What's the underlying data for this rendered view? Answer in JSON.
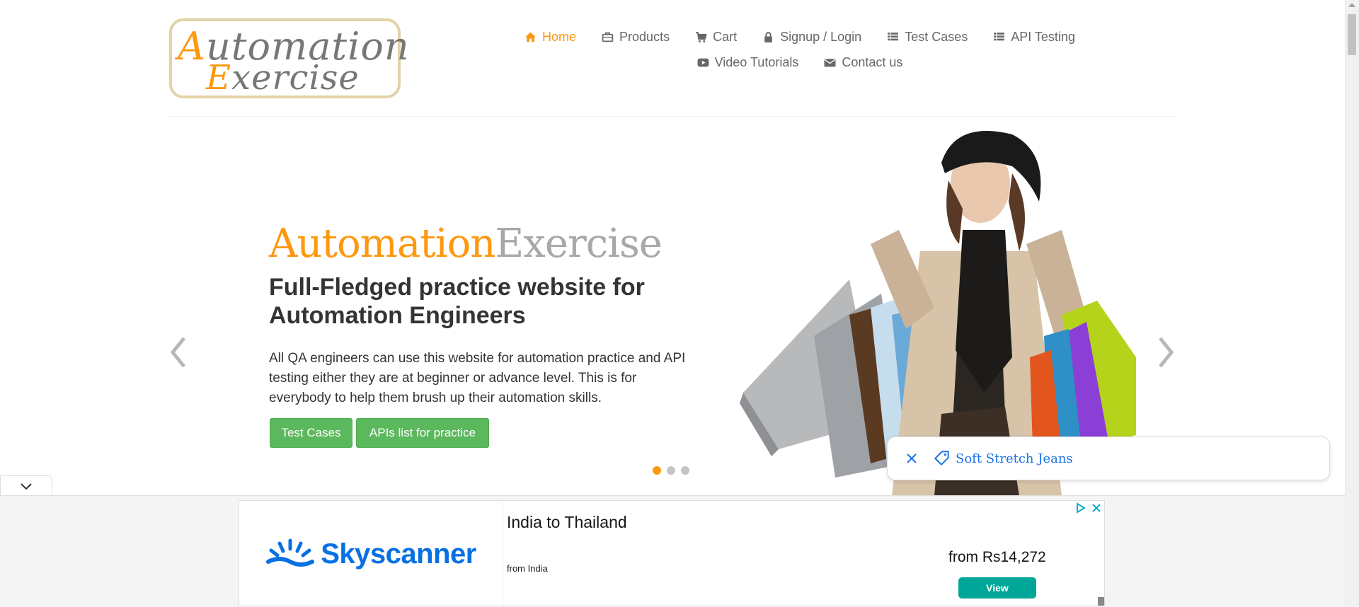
{
  "header": {
    "logo": {
      "line1": "Automation",
      "line2": "Exercise"
    },
    "nav_row1": [
      {
        "label": "Home",
        "icon": "home-icon",
        "active": true
      },
      {
        "label": "Products",
        "icon": "briefcase-icon"
      },
      {
        "label": "Cart",
        "icon": "cart-icon"
      },
      {
        "label": "Signup / Login",
        "icon": "lock-icon"
      },
      {
        "label": "Test Cases",
        "icon": "list-icon"
      },
      {
        "label": "API Testing",
        "icon": "list-icon"
      }
    ],
    "nav_row2": [
      {
        "label": "Video Tutorials",
        "icon": "youtube-icon"
      },
      {
        "label": "Contact us",
        "icon": "envelope-icon"
      }
    ]
  },
  "slider": {
    "brand_part1": "Automation",
    "brand_part2": "Exercise",
    "headline": "Full-Fledged practice website for Automation Engineers",
    "description": "All QA engineers can use this website for automation practice and API testing either they are at beginner or advance level. This is for everybody to help them brush up their automation skills.",
    "button_test_cases": "Test Cases",
    "button_apis": "APIs list for practice",
    "active_slide": 1,
    "slide_count": 3
  },
  "search_chip": {
    "text": "Soft Stretch Jeans"
  },
  "ad": {
    "brand": "Skyscanner",
    "title": "India to Thailand",
    "from_label": "from India",
    "price": "from Rs14,272",
    "cta": "View"
  },
  "colors": {
    "accent": "#fe980f",
    "button_green": "#5cb85c",
    "ad_blue": "#0770e3",
    "ad_teal": "#00a698"
  }
}
